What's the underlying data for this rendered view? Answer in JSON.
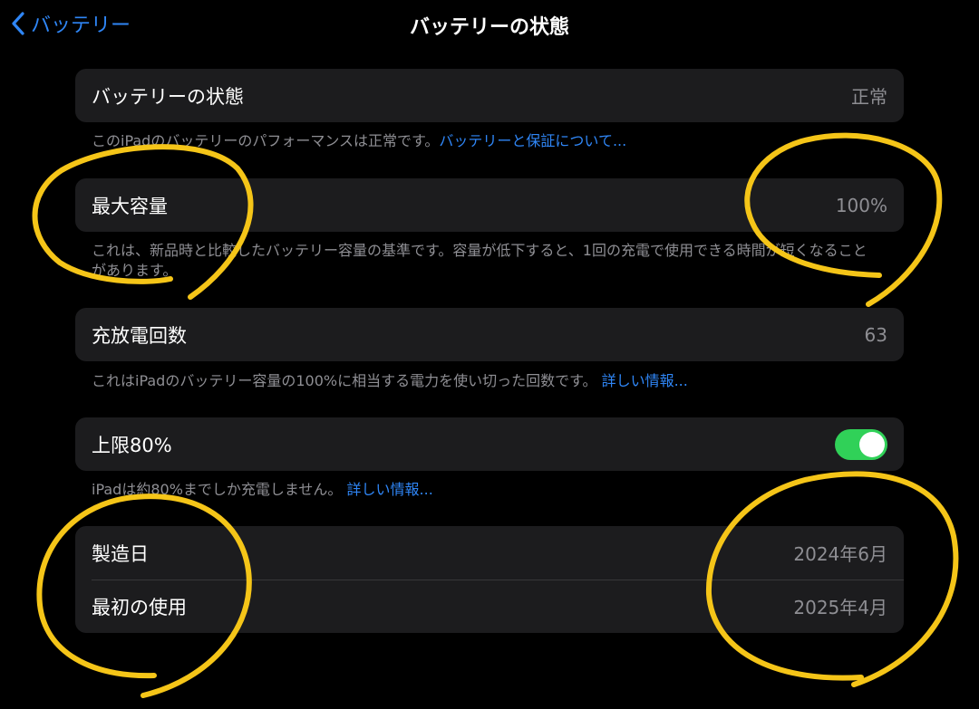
{
  "nav": {
    "back_label": "バッテリー",
    "title": "バッテリーの状態"
  },
  "health": {
    "label": "バッテリーの状態",
    "value": "正常",
    "footer_text": "このiPadのバッテリーのパフォーマンスは正常です。",
    "footer_link": "バッテリーと保証について..."
  },
  "capacity": {
    "label": "最大容量",
    "value": "100%",
    "footer_text": "これは、新品時と比較したバッテリー容量の基準です。容量が低下すると、1回の充電で使用できる時間が短くなることがあります。"
  },
  "cycles": {
    "label": "充放電回数",
    "value": "63",
    "footer_text": "これはiPadのバッテリー容量の100%に相当する電力を使い切った回数です。",
    "footer_link": "詳しい情報..."
  },
  "limit": {
    "label": "上限80%",
    "toggle_on": true,
    "footer_text": "iPadは約80%までしか充電しません。",
    "footer_link": "詳しい情報..."
  },
  "dates": {
    "manufacture_label": "製造日",
    "manufacture_value": "2024年6月",
    "first_use_label": "最初の使用",
    "first_use_value": "2025年4月"
  },
  "colors": {
    "accent": "#2f86f6",
    "toggle_on": "#30d158",
    "annotation": "#f5c518"
  }
}
